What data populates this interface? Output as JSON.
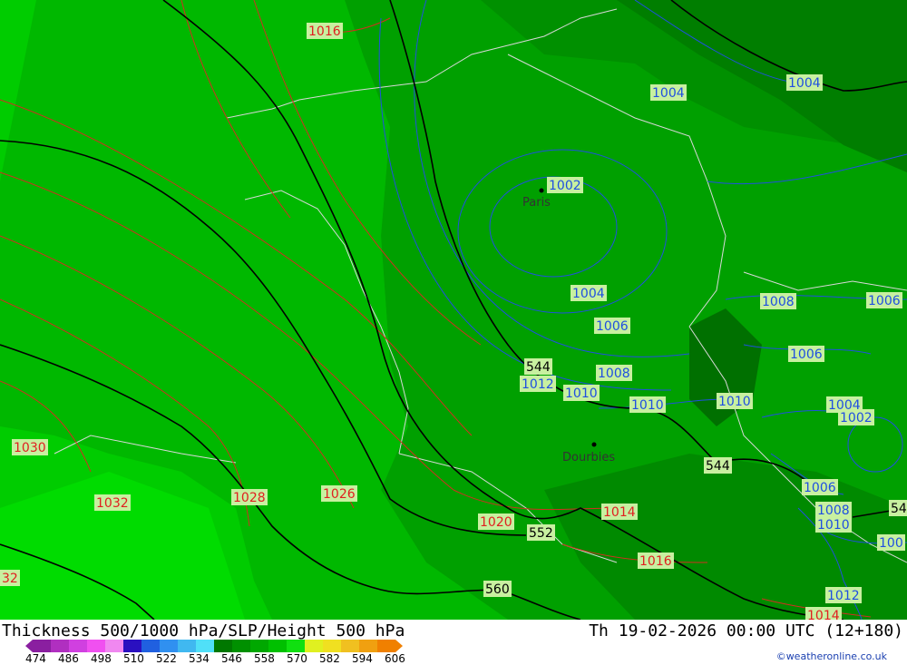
{
  "title": "Thickness 500/1000 hPa/SLP/Height 500 hPa",
  "datetime": "Th 19-02-2026 00:00 UTC (12+180)",
  "credit": "©weatheronline.co.uk",
  "cities": [
    {
      "name": "Paris"
    },
    {
      "name": "Dourbies"
    }
  ],
  "isobar_labels": [
    {
      "text": "1016",
      "color": "red"
    },
    {
      "text": "1004",
      "color": "blue"
    },
    {
      "text": "1004",
      "color": "blue"
    },
    {
      "text": "1002",
      "color": "blue"
    },
    {
      "text": "1004",
      "color": "blue"
    },
    {
      "text": "1006",
      "color": "blue"
    },
    {
      "text": "1008",
      "color": "blue"
    },
    {
      "text": "1006",
      "color": "blue"
    },
    {
      "text": "1006",
      "color": "blue"
    },
    {
      "text": "1008",
      "color": "blue"
    },
    {
      "text": "1012",
      "color": "blue"
    },
    {
      "text": "1010",
      "color": "blue"
    },
    {
      "text": "1010",
      "color": "blue"
    },
    {
      "text": "1010",
      "color": "blue"
    },
    {
      "text": "1004",
      "color": "blue"
    },
    {
      "text": "1002",
      "color": "blue"
    },
    {
      "text": "1006",
      "color": "blue"
    },
    {
      "text": "1008",
      "color": "blue"
    },
    {
      "text": "1010",
      "color": "blue"
    },
    {
      "text": "100",
      "color": "blue"
    },
    {
      "text": "1012",
      "color": "blue"
    },
    {
      "text": "1030",
      "color": "red"
    },
    {
      "text": "1032",
      "color": "red"
    },
    {
      "text": "1028",
      "color": "red"
    },
    {
      "text": "1026",
      "color": "red"
    },
    {
      "text": "1020",
      "color": "red"
    },
    {
      "text": "1014",
      "color": "red"
    },
    {
      "text": "1016",
      "color": "red"
    },
    {
      "text": "1014",
      "color": "red"
    },
    {
      "text": "32",
      "color": "red"
    }
  ],
  "height_labels": [
    {
      "text": "544"
    },
    {
      "text": "544"
    },
    {
      "text": "54"
    },
    {
      "text": "552"
    },
    {
      "text": "560"
    }
  ],
  "scale": {
    "labels": [
      "474",
      "486",
      "498",
      "510",
      "522",
      "534",
      "546",
      "558",
      "570",
      "582",
      "594",
      "606"
    ],
    "colors": [
      "#8a1fa0",
      "#b02fc0",
      "#d040e0",
      "#f050f0",
      "#f088f0",
      "#2a10c0",
      "#2060e0",
      "#3090f0",
      "#40b8f0",
      "#50e0f8",
      "#007800",
      "#009000",
      "#00a800",
      "#00c000",
      "#10e010",
      "#e0f020",
      "#f0e020",
      "#f0c020",
      "#f0a010",
      "#f08000"
    ]
  },
  "colors": {
    "isobar_blue": "#1f4fe0",
    "isobar_red": "#e02020",
    "label_bg": "#c8f0a0",
    "green_1": "#00d800",
    "green_2": "#00c000",
    "green_3": "#00a800",
    "green_4": "#009000",
    "green_5": "#007800"
  }
}
